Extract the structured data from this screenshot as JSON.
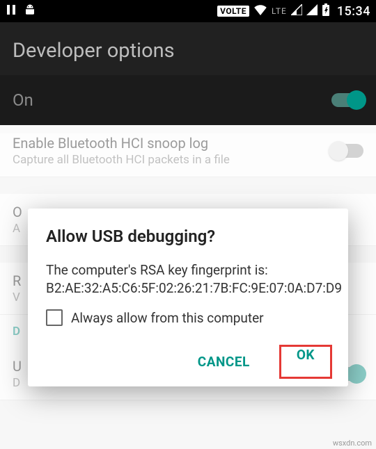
{
  "status": {
    "time": "15:34",
    "volte": "VOLTE",
    "lte": "LTE"
  },
  "header": {
    "title": "Developer options"
  },
  "master": {
    "label": "On"
  },
  "rows": {
    "bt_snoop": {
      "title": "Enable Bluetooth HCI snoop log",
      "sub": "Capture all Bluetooth HCI packets in a file"
    },
    "r1": {
      "title": "O",
      "sub": "A"
    },
    "r2": {
      "title": "R",
      "sub": "V"
    },
    "section": "D",
    "r3": {
      "title": "U",
      "sub": "D"
    }
  },
  "dialog": {
    "title": "Allow USB debugging?",
    "body": "The computer's RSA key fingerprint is:\nB2:AE:32:A5:C6:5F:02:26:21:7B:FC:9E:07:0A:D7:D9",
    "checkbox_label": "Always allow from this computer",
    "cancel": "CANCEL",
    "ok": "OK"
  },
  "watermark": "wsxdn.com"
}
